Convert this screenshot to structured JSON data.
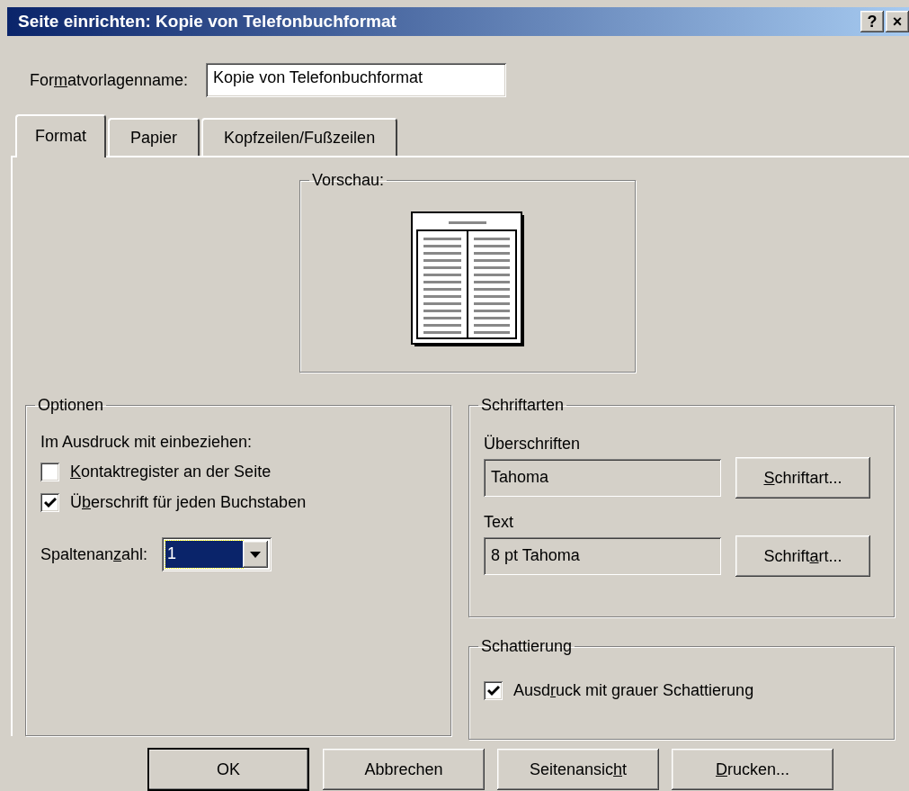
{
  "window": {
    "title": "Seite einrichten: Kopie von Telefonbuchformat",
    "title_buttons": [
      "?",
      "×"
    ]
  },
  "style_name": {
    "label": {
      "pre": "For",
      "key": "m",
      "post": "atvorlagenname:"
    },
    "value": "Kopie von Telefonbuchformat"
  },
  "tabs": [
    {
      "label": "Format",
      "selected": true
    },
    {
      "label": "Papier",
      "selected": false
    },
    {
      "label": "Kopfzeilen/Fußzeilen",
      "selected": false
    }
  ],
  "preview": {
    "title": "Vorschau:"
  },
  "options": {
    "title": "Optionen",
    "intro": "Im Ausdruck mit einbeziehen:",
    "checkboxes": [
      {
        "label": {
          "key": "K",
          "post": "ontaktregister an der Seite"
        },
        "checked": false
      },
      {
        "label": {
          "pre": "Ü",
          "key": "b",
          "post": "erschrift für jeden Buchstaben"
        },
        "checked": true
      }
    ],
    "columns": {
      "label": {
        "pre": "Spaltenan",
        "key": "z",
        "post": "ahl:"
      },
      "value": "1"
    }
  },
  "fonts": {
    "title": "Schriftarten",
    "rows": [
      {
        "label": "Überschriften",
        "value": "Tahoma",
        "button": {
          "key": "S",
          "post": "chriftart..."
        }
      },
      {
        "label": "Text",
        "value": "8 pt Tahoma",
        "button": {
          "pre": "Schrift",
          "key": "a",
          "post": "rt..."
        }
      }
    ]
  },
  "shading": {
    "title": "Schattierung",
    "checkbox": {
      "label": {
        "pre": "Ausd",
        "key": "r",
        "post": "uck mit grauer Schattierung"
      },
      "checked": true
    }
  },
  "buttons": [
    {
      "label": "OK",
      "default": true
    },
    {
      "label": "Abbrechen",
      "default": false
    },
    {
      "label": {
        "pre": "Seitenansic",
        "key": "h",
        "post": "t"
      },
      "default": false
    },
    {
      "label": {
        "key": "D",
        "post": "rucken..."
      },
      "default": false
    }
  ]
}
